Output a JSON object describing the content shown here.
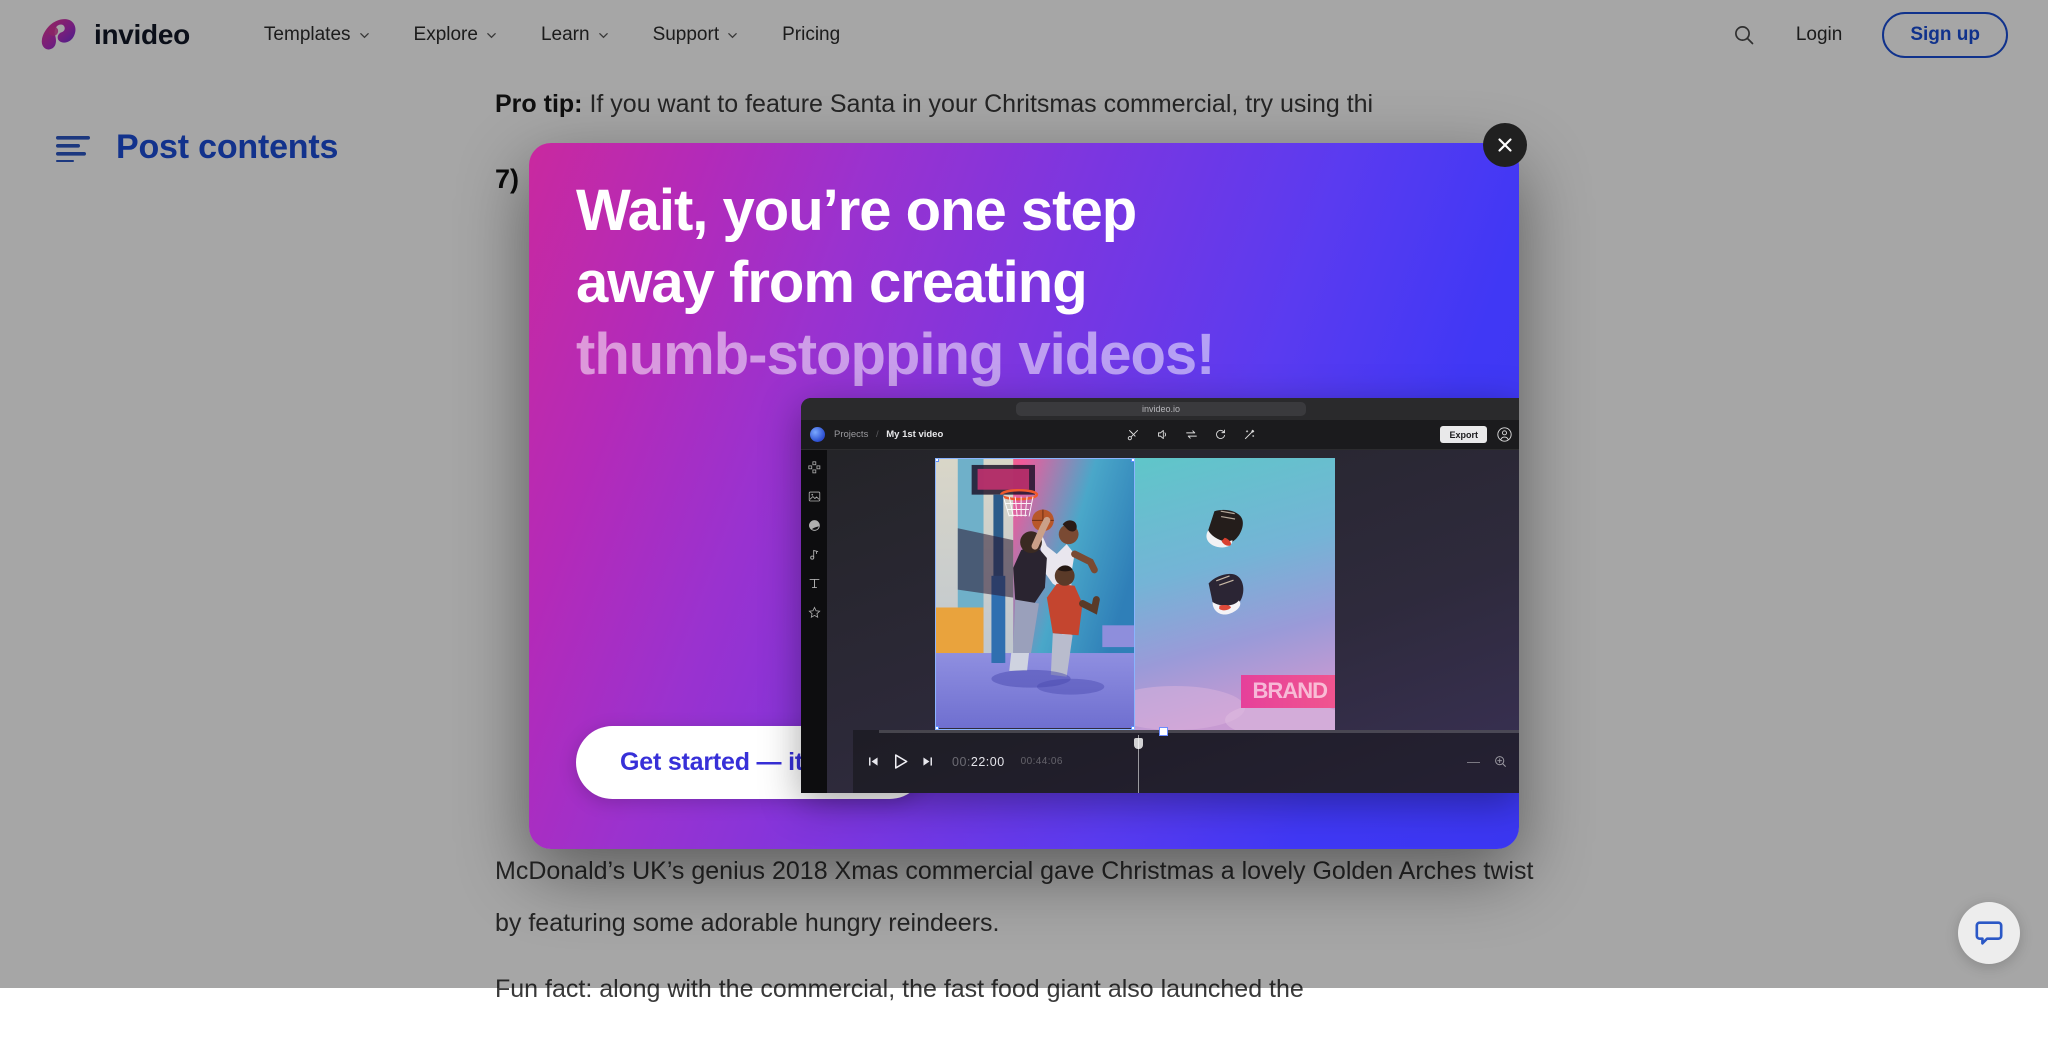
{
  "header": {
    "logo_text": "invideo",
    "logo_icon": "invideo-logo-icon",
    "nav": [
      {
        "label": "Templates",
        "has_caret": true
      },
      {
        "label": "Explore",
        "has_caret": true
      },
      {
        "label": "Learn",
        "has_caret": true
      },
      {
        "label": "Support",
        "has_caret": true
      },
      {
        "label": "Pricing",
        "has_caret": false
      }
    ],
    "search_icon": "search-icon",
    "login_label": "Login",
    "signup_label": "Sign up",
    "accent_color": "#1a4ed8"
  },
  "sidebar": {
    "toc_icon": "list-lines-icon",
    "post_contents_label": "Post contents",
    "color": "#1d4ed8"
  },
  "article": {
    "pro_tip_label": "Pro tip:",
    "pro_tip_body": "If you want to feature Santa in your Chritsmas commercial, try using thi",
    "heading": "7)",
    "para_1": "McDonald’s UK’s genius 2018 Xmas commercial gave Christmas a lovely Golden Arches twist by featuring some adorable hungry reindeers.",
    "para_2": "Fun fact: along with the commercial, the fast food giant also launched the"
  },
  "modal": {
    "close_icon": "close-x-icon",
    "headline_line_1": "Wait, you’re one step",
    "headline_line_2": "away from creating",
    "headline_line_3": "thumb-stopping videos!",
    "cta_label": "Get started — it’s free!",
    "gradient_from": "#c9299f",
    "gradient_to": "#3b37f2",
    "cta_text_color": "#3730d8"
  },
  "editor": {
    "url": "invideo.io",
    "breadcrumb_root": "Projects",
    "breadcrumb_sep": "/",
    "breadcrumb_current": "My 1st video",
    "export_label": "Export",
    "avatar_icon": "user-circle-icon",
    "toolbar_icons": [
      "scissors-icon",
      "volume-icon",
      "swap-arrows-icon",
      "rotate-icon",
      "magic-wand-icon"
    ],
    "sidebar_icons": [
      "layout-grid-icon",
      "media-image-icon",
      "color-fill-icon",
      "music-note-icon",
      "text-icon",
      "star-effects-icon"
    ],
    "brand_label": "BRAND",
    "playback": {
      "prev_icon": "skip-previous-icon",
      "play_icon": "play-icon",
      "next_icon": "skip-next-icon",
      "current_time_dim": "00:",
      "current_time": "22:00",
      "total_time": "00:44:06",
      "zoom_out_icon": "minus-icon",
      "zoom_in_icon": "zoom-in-icon"
    }
  },
  "chat": {
    "icon": "chat-bubble-icon",
    "color": "#2b58c6"
  }
}
